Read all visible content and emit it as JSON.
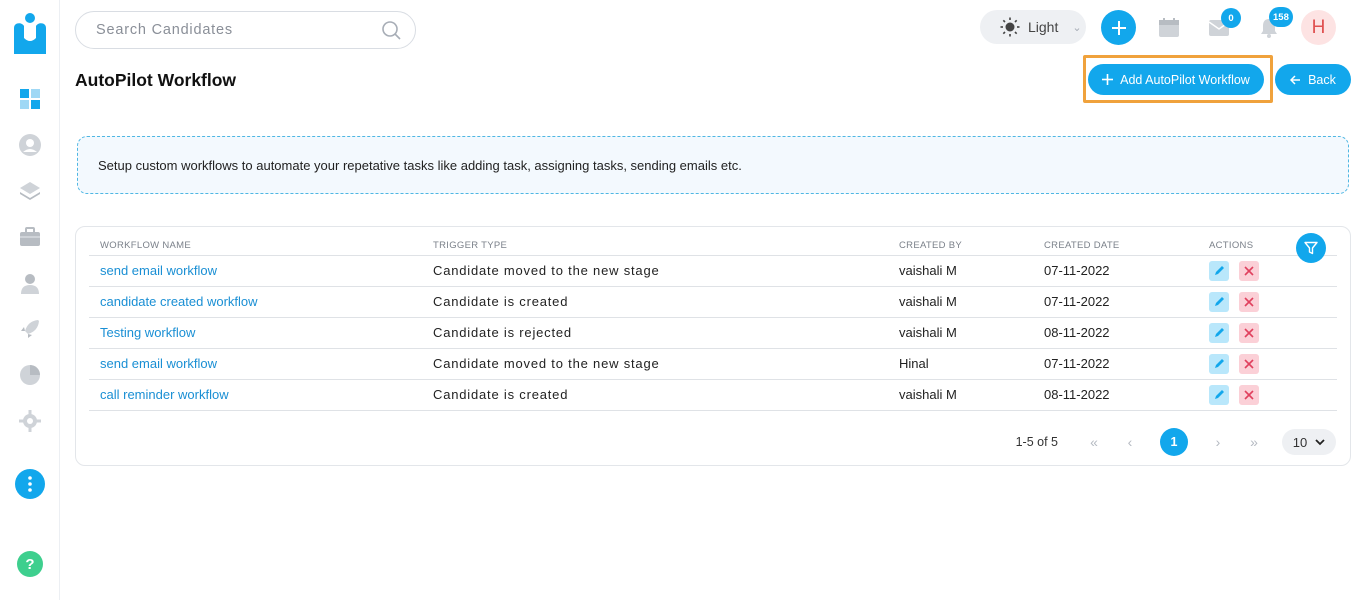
{
  "header": {
    "search_placeholder": "Search Candidates",
    "theme_label": "Light",
    "mail_badge": "0",
    "notification_badge": "158",
    "avatar_initial": "H"
  },
  "page": {
    "title": "AutoPilot Workflow",
    "add_button_label": "Add AutoPilot Workflow",
    "back_button_label": "Back",
    "info_text": "Setup custom workflows to automate your repetative tasks like adding task, assigning tasks, sending emails etc."
  },
  "table": {
    "columns": [
      "WORKFLOW NAME",
      "TRIGGER TYPE",
      "CREATED BY",
      "CREATED DATE",
      "ACTIONS"
    ],
    "rows": [
      {
        "name": "send email workflow",
        "trigger": "Candidate moved to the new stage",
        "created_by": "vaishali M",
        "created_date": "07-11-2022"
      },
      {
        "name": "candidate created workflow",
        "trigger": "Candidate is created",
        "created_by": "vaishali M",
        "created_date": "07-11-2022"
      },
      {
        "name": "Testing workflow",
        "trigger": "Candidate is rejected",
        "created_by": "vaishali M",
        "created_date": "08-11-2022"
      },
      {
        "name": "send email workflow",
        "trigger": "Candidate moved to the new stage",
        "created_by": "Hinal",
        "created_date": "07-11-2022"
      },
      {
        "name": "call reminder workflow",
        "trigger": "Candidate is created",
        "created_by": "vaishali M",
        "created_date": "08-11-2022"
      }
    ]
  },
  "pagination": {
    "range_label": "1-5 of 5",
    "current_page": "1",
    "page_size": "10"
  },
  "sidebar": {
    "icons": [
      "dashboard-icon",
      "candidates-icon",
      "layers-icon",
      "jobs-briefcase-icon",
      "users-icon",
      "autopilot-rocket-icon",
      "reports-pie-icon",
      "settings-gear-icon"
    ]
  },
  "colors": {
    "accent": "#12a7ec",
    "highlight": "#f0a23c",
    "help": "#3ecf8e"
  }
}
